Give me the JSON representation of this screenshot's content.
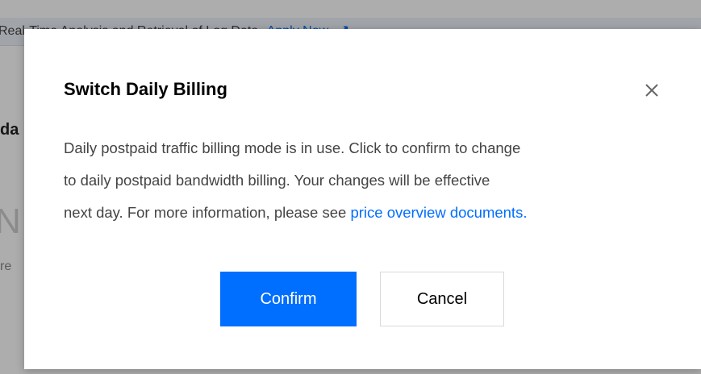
{
  "background": {
    "banner_text": "Real-Time Analysis and Retrieval of Log Data",
    "banner_link": "Apply Now",
    "banner_link_icon": "external-link-icon",
    "heading_fragment": "da",
    "big_fragment": "N",
    "small_fragment": "re"
  },
  "dialog": {
    "title": "Switch Daily Billing",
    "close_icon": "close-icon",
    "body_line1": "Daily postpaid traffic billing mode is in use. Click to confirm to change",
    "body_line2": "to daily postpaid bandwidth billing. Your changes will be effective",
    "body_line3": "next day. For more information, please see ",
    "body_link": "price overview documents.",
    "confirm_label": "Confirm",
    "cancel_label": "Cancel"
  },
  "colors": {
    "primary": "#006eff",
    "overlay": "rgba(0,0,0,0.32)",
    "text": "#444444"
  }
}
